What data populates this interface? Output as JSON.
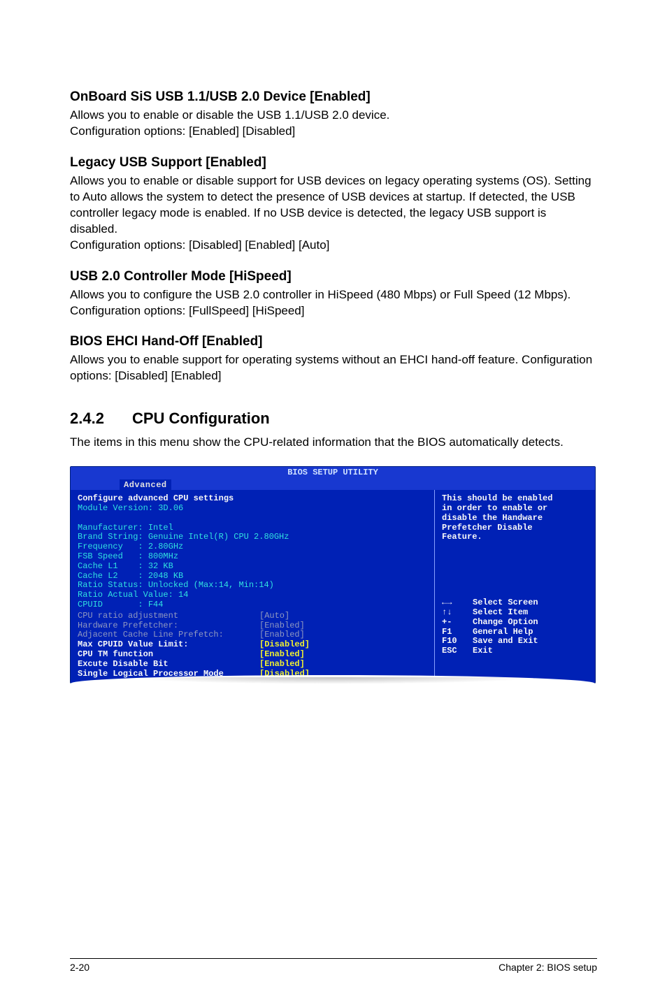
{
  "sections": [
    {
      "title": "OnBoard SiS USB 1.1/USB 2.0 Device [Enabled]",
      "body": "Allows you to enable or disable the USB 1.1/USB 2.0 device.\nConfiguration options: [Enabled] [Disabled]"
    },
    {
      "title": "Legacy USB Support [Enabled]",
      "body": "Allows you to enable or disable support for USB devices on legacy operating systems (OS). Setting to Auto allows the system to detect the presence of USB devices at startup. If detected, the USB controller legacy mode is enabled. If no USB device is detected, the legacy USB support is disabled.\nConfiguration options: [Disabled] [Enabled] [Auto]"
    },
    {
      "title": "USB 2.0 Controller Mode [HiSpeed]",
      "body": "Allows you to configure the USB 2.0 controller in HiSpeed (480 Mbps) or Full Speed (12 Mbps). Configuration options: [FullSpeed] [HiSpeed]"
    },
    {
      "title": "BIOS EHCI Hand-Off [Enabled]",
      "body": "Allows you to enable support for operating systems without an EHCI hand-off feature. Configuration options: [Disabled] [Enabled]"
    }
  ],
  "mainSection": {
    "num": "2.4.2",
    "title": "CPU Configuration",
    "intro": "The items in this menu show the CPU-related information that the BIOS automatically detects."
  },
  "bios": {
    "title": "BIOS SETUP UTILITY",
    "tab": "Advanced",
    "left": {
      "header1": "Configure advanced CPU settings",
      "header2": "Module Version: 3D.06",
      "info": [
        "Manufacturer: Intel",
        "Brand String: Genuine Intel(R) CPU 2.80GHz",
        "Frequency   : 2.80GHz",
        "FSB Speed   : 800MHz",
        "Cache L1    : 32 KB",
        "Cache L2    : 2048 KB",
        "Ratio Status: Unlocked (Max:14, Min:14)",
        "Ratio Actual Value: 14",
        "CPUID       : F44"
      ],
      "opts_grey": [
        {
          "label": "CPU ratio adjustment",
          "value": "[Auto]"
        },
        {
          "label": "Hardware Prefetcher:",
          "value": "[Enabled]"
        },
        {
          "label": "Adjacent Cache Line Prefetch:",
          "value": "[Enabled]"
        }
      ],
      "opts_white": [
        {
          "label": "Max CPUID Value Limit:",
          "value": "[Disabled]"
        },
        {
          "label": "CPU TM function",
          "value": "[Enabled]"
        },
        {
          "label": "Excute Disable Bit",
          "value": "[Enabled]"
        },
        {
          "label": "Single Logical Processor Mode",
          "value": "[Disabled]"
        }
      ]
    },
    "right": {
      "help": [
        "This should be enabled",
        "in order to enable or",
        "disable the Handware",
        "Prefetcher Disable",
        "Feature."
      ],
      "nav": [
        {
          "key": "←→",
          "label": "Select Screen"
        },
        {
          "key": "↑↓",
          "label": "Select Item"
        },
        {
          "key": "+-",
          "label": "Change Option"
        },
        {
          "key": "F1",
          "label": "General Help"
        },
        {
          "key": "F10",
          "label": "Save and Exit"
        },
        {
          "key": "ESC",
          "label": "Exit"
        }
      ]
    }
  },
  "footer": {
    "left": "2-20",
    "right": "Chapter 2: BIOS setup"
  }
}
